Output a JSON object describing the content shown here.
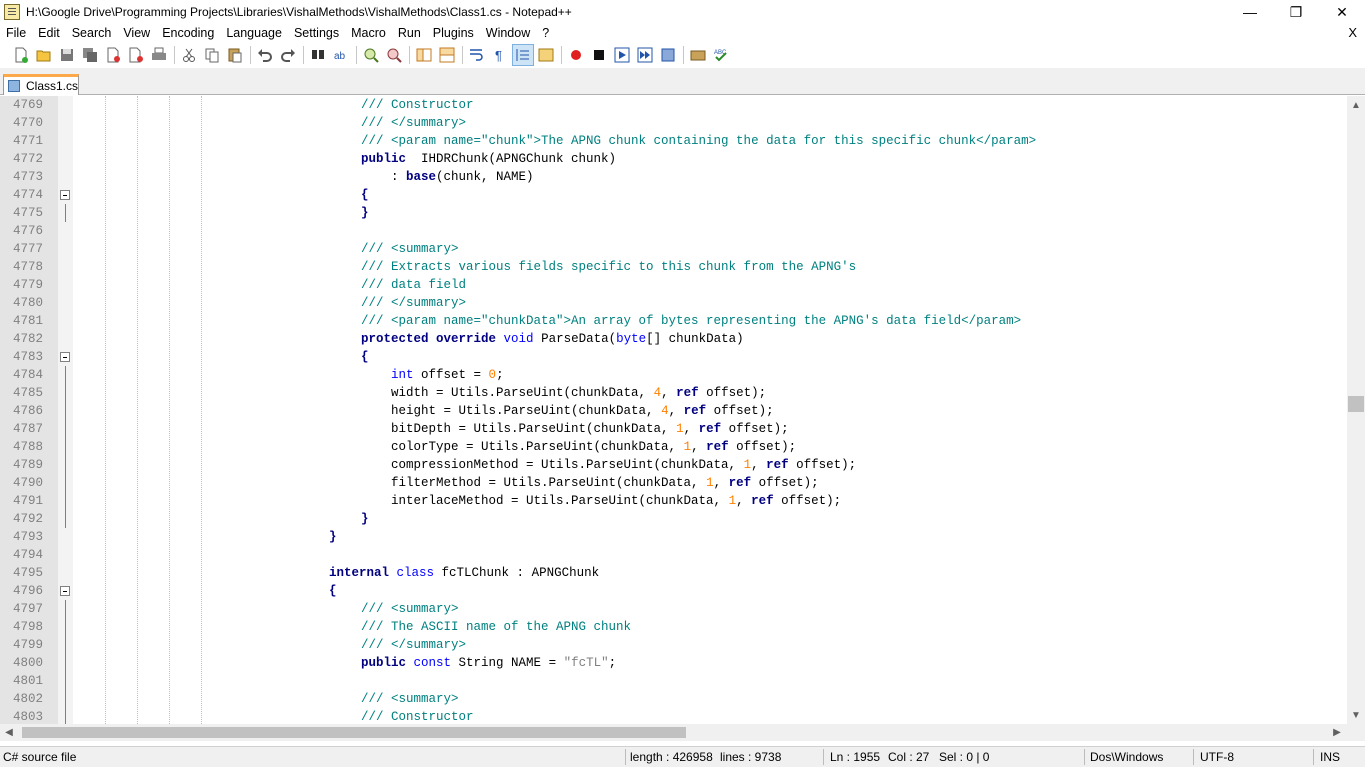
{
  "window": {
    "title": "H:\\Google Drive\\Programming Projects\\Libraries\\VishalMethods\\VishalMethods\\Class1.cs - Notepad++",
    "minimize": "—",
    "maximize": "❐",
    "close": "✕"
  },
  "menu": {
    "items": [
      "File",
      "Edit",
      "Search",
      "View",
      "Encoding",
      "Language",
      "Settings",
      "Macro",
      "Run",
      "Plugins",
      "Window",
      "?"
    ],
    "close": "X"
  },
  "tab": {
    "label": "Class1.cs"
  },
  "editor": {
    "lines": [
      {
        "n": "4769",
        "parts": [
          [
            "cm",
            "/// Constructor"
          ]
        ]
      },
      {
        "n": "4770",
        "parts": [
          [
            "cm",
            "/// </summary>"
          ]
        ]
      },
      {
        "n": "4771",
        "parts": [
          [
            "cm",
            "/// <param name=\"chunk\">The APNG chunk containing the data for this specific chunk</param>"
          ]
        ]
      },
      {
        "n": "4772",
        "parts": [
          [
            "kwb",
            "public"
          ],
          [
            "",
            "  IHDRChunk(APNGChunk chunk)"
          ]
        ]
      },
      {
        "n": "4773",
        "parts": [
          [
            "",
            "    : "
          ],
          [
            "kwb",
            "base"
          ],
          [
            "",
            "(chunk, NAME)"
          ]
        ]
      },
      {
        "n": "4774",
        "parts": [
          [
            "kwb",
            "{"
          ]
        ]
      },
      {
        "n": "4775",
        "parts": [
          [
            "kwb",
            "}"
          ]
        ]
      },
      {
        "n": "4776",
        "parts": []
      },
      {
        "n": "4777",
        "parts": [
          [
            "cm",
            "/// <summary>"
          ]
        ]
      },
      {
        "n": "4778",
        "parts": [
          [
            "cm",
            "/// Extracts various fields specific to this chunk from the APNG's"
          ]
        ]
      },
      {
        "n": "4779",
        "parts": [
          [
            "cm",
            "/// data field"
          ]
        ]
      },
      {
        "n": "4780",
        "parts": [
          [
            "cm",
            "/// </summary>"
          ]
        ]
      },
      {
        "n": "4781",
        "parts": [
          [
            "cm",
            "/// <param name=\"chunkData\">An array of bytes representing the APNG's data field</param>"
          ]
        ]
      },
      {
        "n": "4782",
        "parts": [
          [
            "kwb",
            "protected override"
          ],
          [
            "",
            " "
          ],
          [
            "kw",
            "void"
          ],
          [
            "",
            " ParseData("
          ],
          [
            "kw",
            "byte"
          ],
          [
            "",
            "[] chunkData)"
          ]
        ]
      },
      {
        "n": "4783",
        "parts": [
          [
            "kwb",
            "{"
          ]
        ]
      },
      {
        "n": "4784",
        "parts": [
          [
            "",
            "    "
          ],
          [
            "kw",
            "int"
          ],
          [
            "",
            " offset = "
          ],
          [
            "num",
            "0"
          ],
          [
            "",
            ";"
          ]
        ]
      },
      {
        "n": "4785",
        "parts": [
          [
            "",
            "    width = Utils.ParseUint(chunkData, "
          ],
          [
            "num",
            "4"
          ],
          [
            "",
            ", "
          ],
          [
            "kwb",
            "ref"
          ],
          [
            "",
            " offset);"
          ]
        ]
      },
      {
        "n": "4786",
        "parts": [
          [
            "",
            "    height = Utils.ParseUint(chunkData, "
          ],
          [
            "num",
            "4"
          ],
          [
            "",
            ", "
          ],
          [
            "kwb",
            "ref"
          ],
          [
            "",
            " offset);"
          ]
        ]
      },
      {
        "n": "4787",
        "parts": [
          [
            "",
            "    bitDepth = Utils.ParseUint(chunkData, "
          ],
          [
            "num",
            "1"
          ],
          [
            "",
            ", "
          ],
          [
            "kwb",
            "ref"
          ],
          [
            "",
            " offset);"
          ]
        ]
      },
      {
        "n": "4788",
        "parts": [
          [
            "",
            "    colorType = Utils.ParseUint(chunkData, "
          ],
          [
            "num",
            "1"
          ],
          [
            "",
            ", "
          ],
          [
            "kwb",
            "ref"
          ],
          [
            "",
            " offset);"
          ]
        ]
      },
      {
        "n": "4789",
        "parts": [
          [
            "",
            "    compressionMethod = Utils.ParseUint(chunkData, "
          ],
          [
            "num",
            "1"
          ],
          [
            "",
            ", "
          ],
          [
            "kwb",
            "ref"
          ],
          [
            "",
            " offset);"
          ]
        ]
      },
      {
        "n": "4790",
        "parts": [
          [
            "",
            "    filterMethod = Utils.ParseUint(chunkData, "
          ],
          [
            "num",
            "1"
          ],
          [
            "",
            ", "
          ],
          [
            "kwb",
            "ref"
          ],
          [
            "",
            " offset);"
          ]
        ]
      },
      {
        "n": "4791",
        "parts": [
          [
            "",
            "    interlaceMethod = Utils.ParseUint(chunkData, "
          ],
          [
            "num",
            "1"
          ],
          [
            "",
            ", "
          ],
          [
            "kwb",
            "ref"
          ],
          [
            "",
            " offset);"
          ]
        ]
      },
      {
        "n": "4792",
        "parts": [
          [
            "kwb",
            "}"
          ]
        ]
      },
      {
        "n": "4793",
        "parts": [
          [
            "kwb",
            "}"
          ]
        ]
      },
      {
        "n": "4794",
        "parts": []
      },
      {
        "n": "4795",
        "parts": [
          [
            "kwb",
            "internal"
          ],
          [
            "",
            " "
          ],
          [
            "kw",
            "class"
          ],
          [
            "",
            " fcTLChunk : APNGChunk"
          ]
        ]
      },
      {
        "n": "4796",
        "parts": [
          [
            "kwb",
            "{"
          ]
        ]
      },
      {
        "n": "4797",
        "parts": [
          [
            "cm",
            "/// <summary>"
          ]
        ]
      },
      {
        "n": "4798",
        "parts": [
          [
            "cm",
            "/// The ASCII name of the APNG chunk"
          ]
        ]
      },
      {
        "n": "4799",
        "parts": [
          [
            "cm",
            "/// </summary>"
          ]
        ]
      },
      {
        "n": "4800",
        "parts": [
          [
            "kwb",
            "public"
          ],
          [
            "",
            " "
          ],
          [
            "kw",
            "const"
          ],
          [
            "",
            " String NAME = "
          ],
          [
            "str",
            "\"fcTL\""
          ],
          [
            "",
            ";"
          ]
        ]
      },
      {
        "n": "4801",
        "parts": []
      },
      {
        "n": "4802",
        "parts": [
          [
            "cm",
            "/// <summary>"
          ]
        ]
      },
      {
        "n": "4803",
        "parts": [
          [
            "cm",
            "/// Constructor"
          ]
        ]
      }
    ]
  },
  "status": {
    "file_type": "C# source file",
    "length": "length : 426958",
    "lines": "lines : 9738",
    "ln": "Ln : 1955",
    "col": "Col : 27",
    "sel": "Sel : 0 | 0",
    "eol": "Dos\\Windows",
    "encoding": "UTF-8",
    "mode": "INS"
  },
  "colors": {
    "comment": "#008080",
    "keyword": "#0000ff",
    "keyword_bold": "#000080",
    "number": "#ff8000",
    "string": "#808080",
    "tab_accent": "#fba94a"
  }
}
